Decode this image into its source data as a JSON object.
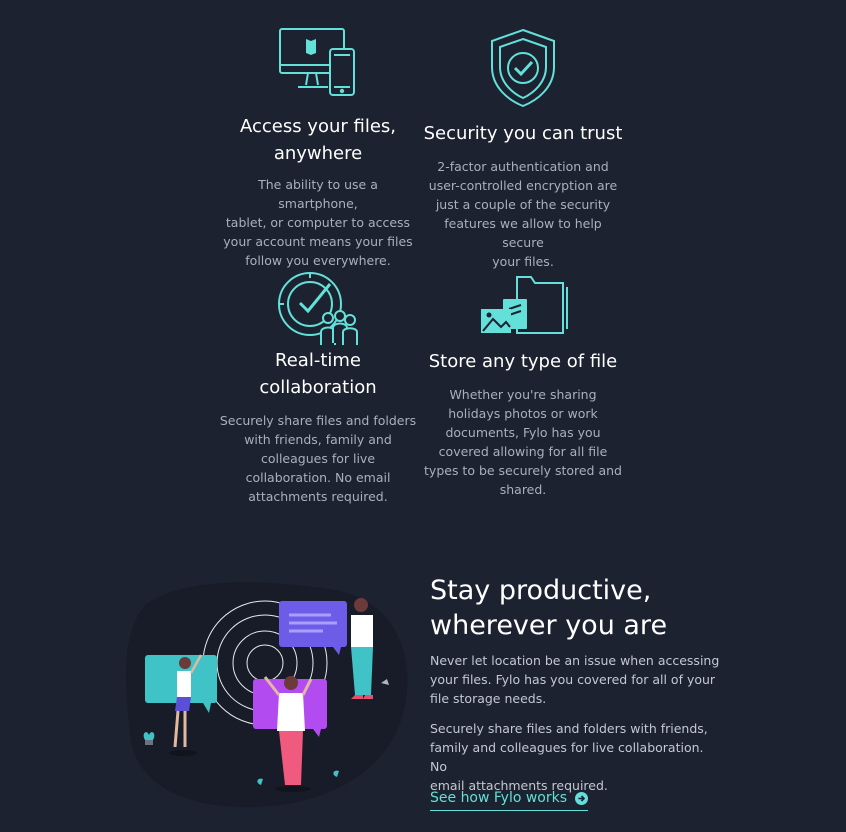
{
  "features": [
    {
      "icon": "devices-icon",
      "title_line1": "Access your files,",
      "title_line2": "anywhere",
      "desc_lines": [
        "The ability to use a smartphone,",
        "tablet, or computer to access",
        "your account means your files",
        "follow you everywhere."
      ]
    },
    {
      "icon": "shield-check-icon",
      "title_line1": "Security you can trust",
      "desc_lines": [
        "2-factor authentication and",
        "user-controlled encryption are",
        "just a couple of the security",
        "features we allow to help secure",
        "your files."
      ]
    },
    {
      "icon": "collaboration-icon",
      "title_line1": "Real-time",
      "title_line2": "collaboration",
      "desc_lines": [
        "Securely share files and folders",
        "with friends, family and",
        "colleagues for live",
        "collaboration. No email",
        "attachments required."
      ]
    },
    {
      "icon": "folder-files-icon",
      "title_line1": "Store any type of file",
      "desc_lines": [
        "Whether you're sharing",
        "holidays photos or work",
        "documents, Fylo has you",
        "covered allowing for all file",
        "types to be securely stored and",
        "shared."
      ]
    }
  ],
  "productive": {
    "title_line1": "Stay productive,",
    "title_line2": "wherever you are",
    "p1_lines": [
      "Never let location be an issue when accessing",
      "your files. Fylo has you covered for all of your",
      "file storage needs."
    ],
    "p2_lines": [
      "Securely share files and folders with friends,",
      "family and colleagues for live collaboration. No",
      "email attachments required."
    ],
    "link_label": "See how Fylo works",
    "link_icon": "arrow-circle-right-icon"
  },
  "colors": {
    "background": "#1c2230",
    "accent": "#62e0d9",
    "text_muted": "#a8b0bf"
  }
}
